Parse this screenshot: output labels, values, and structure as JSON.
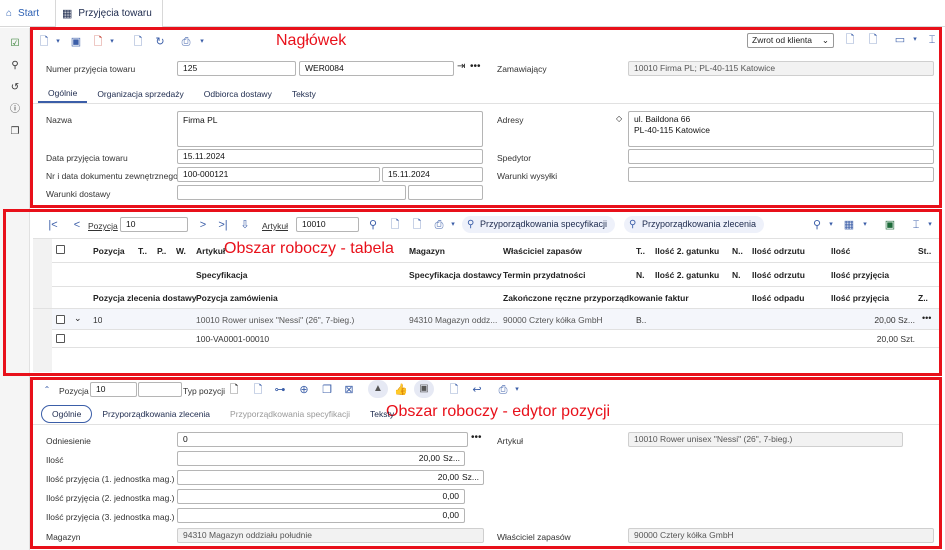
{
  "topbar": {
    "home_label": "Start",
    "doc_tab_label": "Przyjęcia towaru"
  },
  "annotations": {
    "header": "Nagłówek",
    "table": "Obszar roboczy - tabela",
    "editor": "Obszar roboczy - edytor pozycji"
  },
  "header": {
    "return_dropdown": "Zwrot od klienta",
    "receipt_number_label": "Numer przyjęcia towaru",
    "receipt_number": "125",
    "receipt_code": "WER0084",
    "ordering_label": "Zamawiający",
    "ordering_value": "10010 Firma PL; PL-40-115 Katowice",
    "tabs": [
      "Ogólnie",
      "Organizacja sprzedaży",
      "Odbiorca dostawy",
      "Teksty"
    ],
    "name_label": "Nazwa",
    "name_value": "Firma PL",
    "addresses_label": "Adresy",
    "address_line1": "ul. Baildona 66",
    "address_line2": "PL-40-115 Katowice",
    "receipt_date_label": "Data przyjęcia towaru",
    "receipt_date": "15.11.2024",
    "forwarder_label": "Spedytor",
    "ext_doc_label": "Nr i data dokumentu zewnętrznego",
    "ext_doc_number": "100-000121",
    "ext_doc_date": "15.11.2024",
    "shipping_terms_label": "Warunki wysyłki",
    "delivery_terms_label": "Warunki dostawy"
  },
  "table": {
    "position_label": "Pozycja",
    "position_value": "10",
    "article_label": "Artykuł",
    "article_value": "10010",
    "spec_assign_button": "Przyporządkowania specyfikacji",
    "order_assign_button": "Przyporządkowania zlecenia",
    "headers_row1": [
      "Pozycja",
      "T..",
      "P..",
      "W.",
      "Artykuł",
      "Magazyn",
      "Właściciel zapasów",
      "T..",
      "Ilość 2. gatunku",
      "N..",
      "Ilość odrzutu",
      "Ilość",
      "St.."
    ],
    "headers_row2": [
      "Specyfikacja",
      "Specyfikacja dostawcy",
      "Termin przydatności",
      "N.",
      "Ilość 2. gatunku",
      "N.",
      "Ilość odrzutu",
      "Ilość przyjęcia"
    ],
    "headers_row3": [
      "Pozycja zlecenia dostawy",
      "Pozycja zamówienia",
      "Zakończone ręczne przyporządkowanie faktur",
      "Ilość odpadu",
      "Ilość przyjęcia",
      "Z.."
    ],
    "row1": {
      "position": "10",
      "article": "10010 Rower unisex \"Nessi\" (26\", 7-bieg.)",
      "warehouse": "94310 Magazyn oddz...",
      "owner": "90000 Cztery kółka GmbH",
      "type": "B..",
      "quantity": "20,00 Sz..."
    },
    "row2": {
      "article": "100-VA0001-00010",
      "quantity": "20,00 Szt."
    }
  },
  "editor": {
    "position_label": "Pozycja",
    "position_value": "10",
    "position_type_label": "Typ pozycji",
    "tabs": [
      "Ogólnie",
      "Przyporządkowania zlecenia",
      "Przyporządkowania specyfikacji",
      "Teksty"
    ],
    "reference_label": "Odniesienie",
    "reference_value": "0",
    "article_label": "Artykuł",
    "article_value": "10010 Rower unisex \"Nessi\" (26\", 7-bieg.)",
    "quantity_label": "Ilość",
    "quantity_value": "20,00",
    "quantity_unit": "Sz...",
    "recv_qty1_label": "Ilość przyjęcia (1. jednostka mag.)",
    "recv_qty1_value": "20,00",
    "recv_qty1_unit": "Sz...",
    "recv_qty2_label": "Ilość przyjęcia (2. jednostka mag.)",
    "recv_qty2_value": "0,00",
    "recv_qty3_label": "Ilość przyjęcia (3. jednostka mag.)",
    "recv_qty3_value": "0,00",
    "warehouse_label": "Magazyn",
    "warehouse_value": "94310 Magazyn oddziału południe",
    "owner_label": "Właściciel zapasów",
    "owner_value": "90000 Cztery kółka GmbH"
  },
  "colors": {
    "accent": "#3b5ea8",
    "annotation_red": "#e8101a"
  }
}
